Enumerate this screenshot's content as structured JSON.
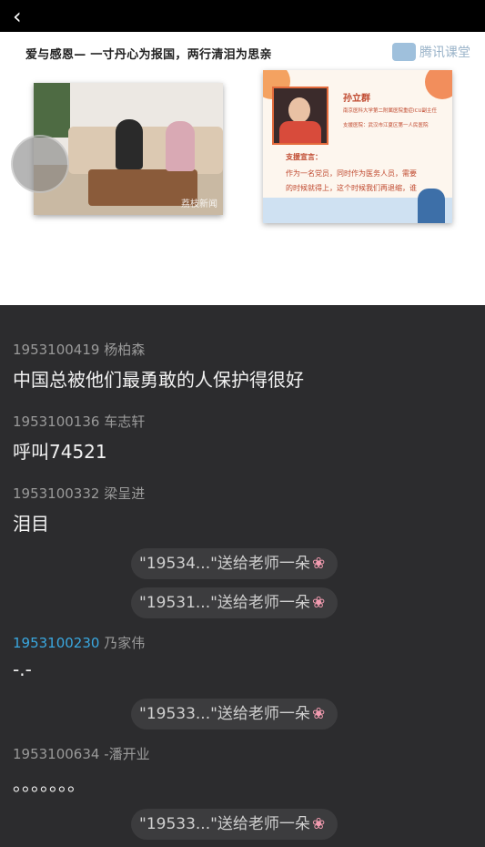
{
  "slide": {
    "title": "爱与感恩— 一寸丹心为报国，两行清泪为思亲",
    "logo": "腾讯课堂",
    "left_photo_watermark": "荔枝新闻",
    "poster": {
      "name": "孙立群",
      "line1": "南京医科大学第二附属医院重症ICU副主任",
      "line2": "支援医院：武汉市江夏区第一人民医院",
      "subhead": "支援宣言：",
      "quote": "作为一名党员，同时作为医务人员，需要的时候就得上，这个时候我们再退缩，谁来上？"
    }
  },
  "messages": [
    {
      "id": "1953100419",
      "name": "杨柏森",
      "text": "中国总被他们最勇敢的人保护得很好"
    },
    {
      "id": "1953100136",
      "name": "车志轩",
      "text": "呼叫74521"
    },
    {
      "id": "1953100332",
      "name": "梁呈进",
      "text": "泪目"
    },
    {
      "id": "1953100230",
      "name": "乃家伟",
      "text": "-.-"
    },
    {
      "id": "1953100634",
      "name": "-潘开业",
      "text": "。。。。。。。"
    }
  ],
  "gifts": [
    {
      "text": "\"19534...\"送给老师一朵"
    },
    {
      "text": "\"19531...\"送给老师一朵"
    },
    {
      "text": "\"19533...\"送给老师一朵"
    },
    {
      "text": "\"19533...\"送给老师一朵"
    }
  ],
  "colors": {
    "chat_bg": "#2c2c2e",
    "highlight_id": "#3aa8e0",
    "flower": "#f29bb0"
  }
}
